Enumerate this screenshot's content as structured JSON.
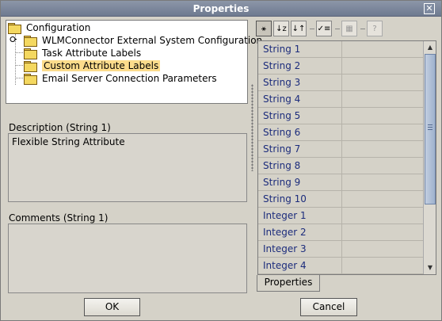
{
  "window": {
    "title": "Properties",
    "close_glyph": "✕"
  },
  "tree": {
    "items": [
      {
        "label": "Configuration",
        "icon": "folder-icon"
      },
      {
        "label": "WLMConnector External System Configuration",
        "icon": "folder-icon",
        "expander": "o-"
      },
      {
        "label": "Task Attribute Labels",
        "icon": "folder-icon"
      },
      {
        "label": "Custom Attribute Labels",
        "icon": "folder-icon",
        "selected": true
      },
      {
        "label": "Email Server Connection Parameters",
        "icon": "folder-icon"
      }
    ]
  },
  "description": {
    "label": "Description (String 1)",
    "value": "Flexible String Attribute"
  },
  "comments": {
    "label": "Comments (String 1)",
    "value": ""
  },
  "toolbar": {
    "buttons": [
      {
        "name": "categorized-icon",
        "glyph": "⚹",
        "pressed": true
      },
      {
        "name": "sort-alphabetical-icon",
        "glyph": "↓z"
      },
      {
        "name": "sort-reverse-icon",
        "glyph": "↓↑"
      },
      {
        "name": "checklist-icon",
        "glyph": "✓≡"
      },
      {
        "name": "property-pages-icon",
        "glyph": "▦",
        "disabled": true
      },
      {
        "name": "help-icon",
        "glyph": "?",
        "disabled": true
      }
    ]
  },
  "grid": {
    "rows": [
      {
        "name": "String 1",
        "value": ""
      },
      {
        "name": "String 2",
        "value": ""
      },
      {
        "name": "String 3",
        "value": ""
      },
      {
        "name": "String 4",
        "value": ""
      },
      {
        "name": "String 5",
        "value": ""
      },
      {
        "name": "String 6",
        "value": ""
      },
      {
        "name": "String 7",
        "value": ""
      },
      {
        "name": "String 8",
        "value": ""
      },
      {
        "name": "String 9",
        "value": ""
      },
      {
        "name": "String 10",
        "value": ""
      },
      {
        "name": "Integer 1",
        "value": ""
      },
      {
        "name": "Integer 2",
        "value": ""
      },
      {
        "name": "Integer 3",
        "value": ""
      },
      {
        "name": "Integer 4",
        "value": ""
      }
    ],
    "scroll_up_glyph": "▲",
    "scroll_down_glyph": "▼"
  },
  "tab": {
    "label": "Properties"
  },
  "buttons": {
    "ok_label": "OK",
    "cancel_label": "Cancel"
  }
}
